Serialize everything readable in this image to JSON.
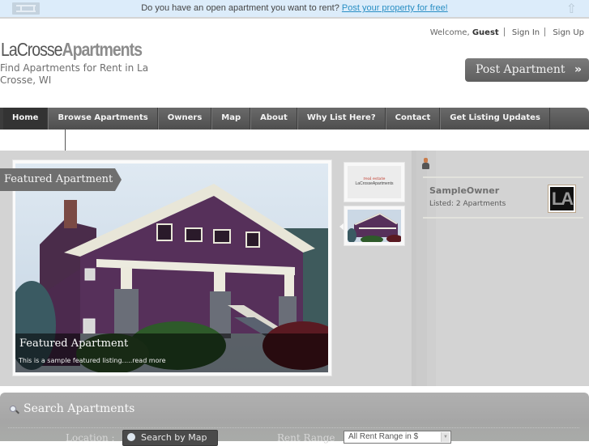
{
  "topbar": {
    "message": "Do you have an open apartment you want to rent?",
    "link_label": "Post your property for free!",
    "scroll_top_icon": "up-arrow-icon",
    "logo_icon": "site-mini-logo-icon"
  },
  "header": {
    "brand_part1": "LaCrosse",
    "brand_part2": "Apartments",
    "tagline": "Find Apartments for Rent in La Crosse, WI",
    "welcome_prefix": "Welcome,",
    "welcome_user": "Guest",
    "sign_in": "Sign In",
    "sign_up": "Sign Up",
    "post_button": "Post Apartment",
    "post_button_icon": "»"
  },
  "nav": {
    "items": [
      {
        "label": "Home",
        "active": true
      },
      {
        "label": "Browse Apartments"
      },
      {
        "label": "Owners"
      },
      {
        "label": "Map"
      },
      {
        "label": "About"
      },
      {
        "label": "Why List Here?"
      },
      {
        "label": "Contact"
      },
      {
        "label": "Get Listing Updates"
      }
    ]
  },
  "featured": {
    "ribbon": "Featured Apartment",
    "caption_title": "Featured Apartment",
    "caption_text": "This is a sample featured listing.....",
    "read_more": "read more",
    "thumbs": [
      {
        "line1": "real estate",
        "line2": "LaCrosseApartments"
      },
      {
        "alt": "purple house thumbnail"
      }
    ]
  },
  "sidebar": {
    "owner_name": "SampleOwner",
    "owner_listed": "Listed: 2 Apartments",
    "avatar_text": "LA"
  },
  "search": {
    "title": "Search Apartments",
    "location_label": "Location :",
    "map_button": "Search by Map",
    "rent_label": "Rent Range",
    "rent_selected": "All Rent Range in $"
  },
  "colors": {
    "topbar_bg": "#dcecfa",
    "link": "#2a8fc4",
    "nav_bg": "#5c5c5c",
    "nav_active": "#333333",
    "main_bg": "#d3d3d3",
    "search_bg": "#aaaaaa"
  }
}
